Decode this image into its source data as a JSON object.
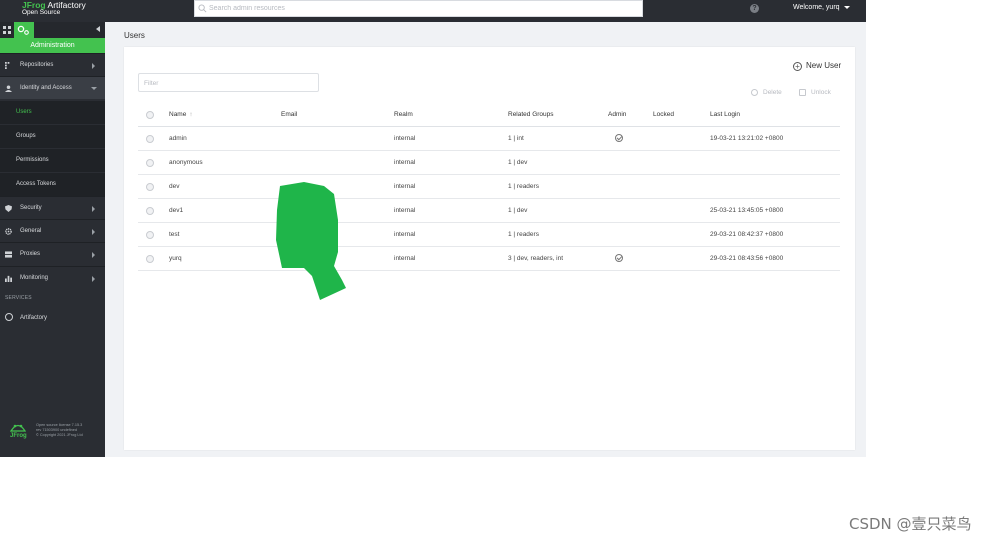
{
  "brand": {
    "name_prefix": "JFrog",
    "name": "Artifactory",
    "edition": "Open Source"
  },
  "search": {
    "placeholder": "Search admin resources"
  },
  "header": {
    "welcome": "Welcome, yurq"
  },
  "sidebar": {
    "module": "Administration",
    "items": [
      {
        "label": "Repositories",
        "icon": "repositories-icon"
      },
      {
        "label": "Identity and Access",
        "icon": "user-icon",
        "expanded": true,
        "children": [
          {
            "label": "Users",
            "active": true
          },
          {
            "label": "Groups"
          },
          {
            "label": "Permissions"
          },
          {
            "label": "Access Tokens"
          }
        ]
      },
      {
        "label": "Security",
        "icon": "shield-icon"
      },
      {
        "label": "General",
        "icon": "gear-icon"
      },
      {
        "label": "Proxies",
        "icon": "server-icon"
      },
      {
        "label": "Monitoring",
        "icon": "chart-icon"
      }
    ],
    "services_label": "SERVICES",
    "services": [
      {
        "label": "Artifactory",
        "icon": "artifactory-icon"
      }
    ],
    "footer": {
      "logo_text": "JFrog",
      "line1": "Open source license 7.15.3",
      "line2": "rev 71503900 undefined",
      "line3": "© Copyright 2021 JFrog Ltd"
    }
  },
  "page": {
    "title": "Users"
  },
  "toolbar": {
    "filter_placeholder": "Filter",
    "new_user": "New User",
    "delete": "Delete",
    "unlock": "Unlock"
  },
  "table": {
    "columns": [
      "Name",
      "Email",
      "Realm",
      "Related Groups",
      "Admin",
      "Locked",
      "Last Login"
    ],
    "rows": [
      {
        "name": "admin",
        "email": "",
        "realm": "internal",
        "groups": "1 | int",
        "admin": true,
        "locked": "",
        "last_login": "19-03-21 13:21:02 +0800"
      },
      {
        "name": "anonymous",
        "email": "",
        "realm": "internal",
        "groups": "1 | dev",
        "admin": false,
        "locked": "",
        "last_login": ""
      },
      {
        "name": "dev",
        "email": "",
        "realm": "internal",
        "groups": "1 | readers",
        "admin": false,
        "locked": "",
        "last_login": ""
      },
      {
        "name": "dev1",
        "email": "",
        "realm": "internal",
        "groups": "1 | dev",
        "admin": false,
        "locked": "",
        "last_login": "25-03-21 13:45:05 +0800"
      },
      {
        "name": "test",
        "email": "",
        "realm": "internal",
        "groups": "1 | readers",
        "admin": false,
        "locked": "",
        "last_login": "29-03-21 08:42:37 +0800"
      },
      {
        "name": "yurq",
        "email": "",
        "realm": "internal",
        "groups": "3 | dev, readers, int",
        "admin": true,
        "locked": "",
        "last_login": "29-03-21 08:43:56 +0800"
      }
    ]
  },
  "colors": {
    "accent": "#43c24f",
    "sidebar_bg": "#2a2d33",
    "topbar_bg": "#2a2d33",
    "redaction": "#1fb54a"
  },
  "watermark": "CSDN @壹只菜鸟"
}
